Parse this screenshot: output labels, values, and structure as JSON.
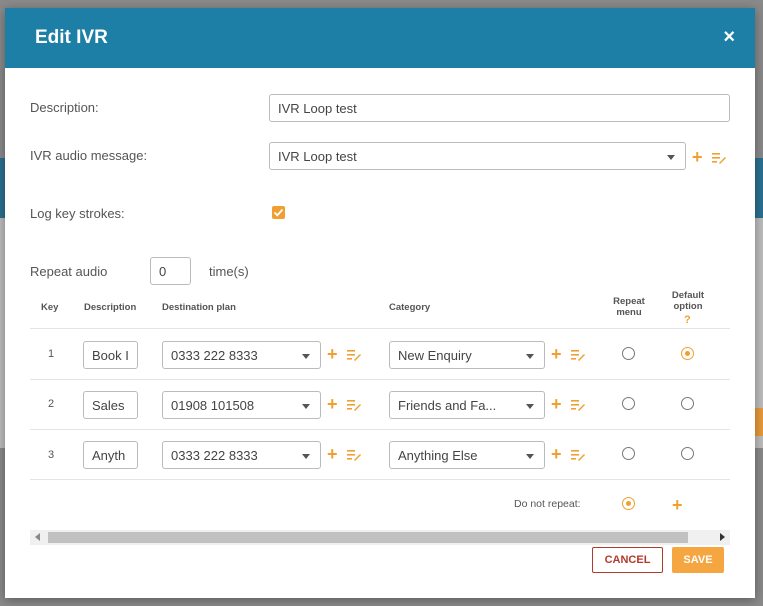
{
  "dialog": {
    "title": "Edit IVR",
    "close_glyph": "×"
  },
  "form": {
    "description_label": "Description:",
    "description_value": "IVR Loop test",
    "audio_label": "IVR audio message:",
    "audio_value": "IVR Loop test",
    "log_label": "Log key strokes:",
    "log_checked": true,
    "repeat_label": "Repeat audio",
    "repeat_value": "0",
    "repeat_suffix": "time(s)"
  },
  "table": {
    "headers": {
      "key": "Key",
      "description": "Description",
      "destination": "Destination plan",
      "category": "Category",
      "repeat_1": "Repeat",
      "repeat_2": "menu",
      "default_1": "Default",
      "default_2": "option",
      "default_help": "?"
    },
    "rows": [
      {
        "key": "1",
        "description": "Book I",
        "destination": "0333 222 8333",
        "category": "New Enquiry",
        "repeat": false,
        "default": true
      },
      {
        "key": "2",
        "description": "Sales",
        "destination": "01908 101508",
        "category": "Friends and Fa...",
        "repeat": false,
        "default": false
      },
      {
        "key": "3",
        "description": "Anyth",
        "destination": "0333 222 8333",
        "category": "Anything Else",
        "repeat": false,
        "default": false
      }
    ],
    "do_not_repeat_label": "Do not repeat:",
    "do_not_repeat_selected": true
  },
  "buttons": {
    "cancel": "CANCEL",
    "save": "SAVE"
  },
  "colors": {
    "header": "#1d7ea6",
    "accent": "#f0a030",
    "cancel": "#b23a2a"
  }
}
